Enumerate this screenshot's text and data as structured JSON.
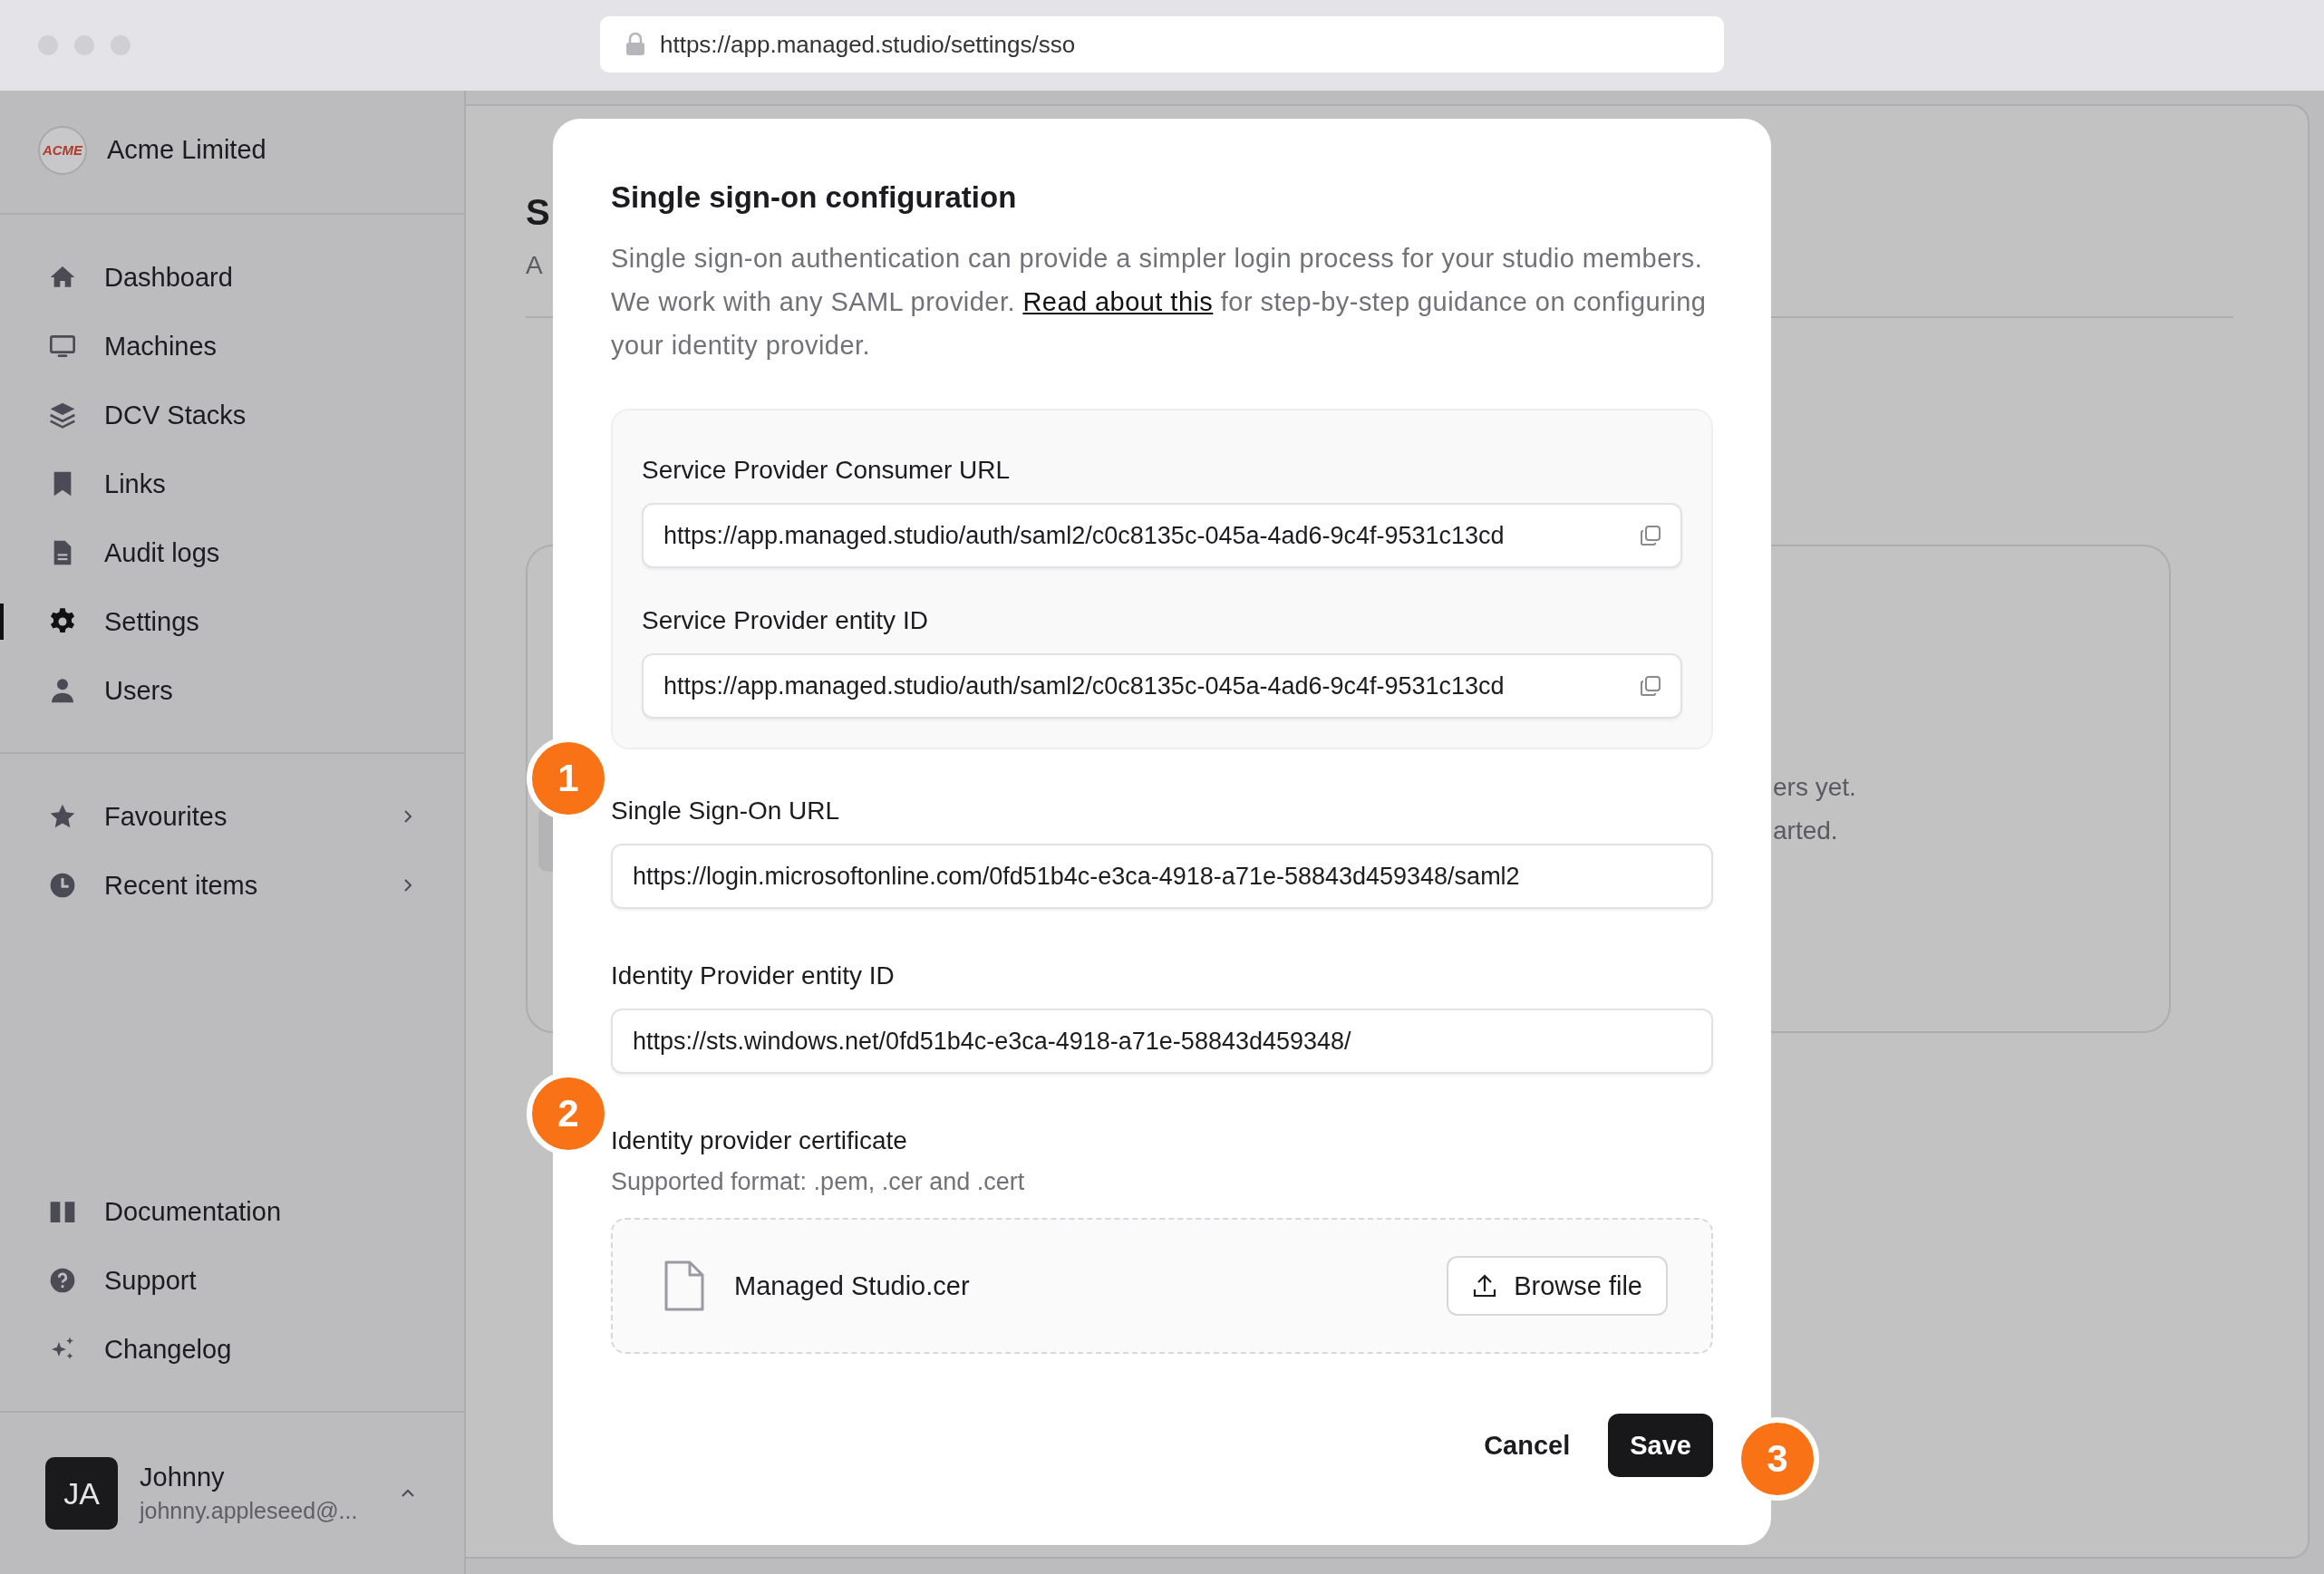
{
  "browser": {
    "url": "https://app.managed.studio/settings/sso"
  },
  "sidebar": {
    "org": {
      "logo_text": "ACME",
      "name": "Acme Limited"
    },
    "nav_main": [
      {
        "label": "Dashboard",
        "selected": false
      },
      {
        "label": "Machines",
        "selected": false
      },
      {
        "label": "DCV Stacks",
        "selected": false
      },
      {
        "label": "Links",
        "selected": false
      },
      {
        "label": "Audit logs",
        "selected": false
      },
      {
        "label": "Settings",
        "selected": true
      },
      {
        "label": "Users",
        "selected": false
      }
    ],
    "nav_secondary": [
      {
        "label": "Favourites",
        "expandable": true
      },
      {
        "label": "Recent items",
        "expandable": true
      }
    ],
    "nav_footer": [
      {
        "label": "Documentation"
      },
      {
        "label": "Support"
      },
      {
        "label": "Changelog"
      }
    ],
    "user": {
      "initials": "JA",
      "name": "Johnny",
      "email": "johnny.appleseed@..."
    }
  },
  "page": {
    "title": "S",
    "subtitle": "A",
    "empty_state": [
      "ers yet.",
      "arted."
    ]
  },
  "modal": {
    "title": "Single sign-on configuration",
    "description": {
      "before": "Single sign-on authentication can provide a simpler login process for your studio members. We work with any SAML provider. ",
      "link": "Read about this",
      "after": " for step-by-step guidance on configuring your identity provider."
    },
    "service_provider": [
      {
        "label": "Service Provider Consumer URL",
        "value": "https://app.managed.studio/auth/saml2/c0c8135c-045a-4ad6-9c4f-9531c13cd"
      },
      {
        "label": "Service Provider entity ID",
        "value": "https://app.managed.studio/auth/saml2/c0c8135c-045a-4ad6-9c4f-9531c13cd"
      }
    ],
    "fields": [
      {
        "label": "Single Sign-On URL",
        "value": "https://login.microsoftonline.com/0fd51b4c-e3ca-4918-a71e-58843d459348/saml2"
      },
      {
        "label": "Identity Provider entity ID",
        "value": "https://sts.windows.net/0fd51b4c-e3ca-4918-a71e-58843d459348/"
      }
    ],
    "certificate": {
      "label": "Identity provider certificate",
      "hint": "Supported format: .pem, .cer and .cert",
      "file_name": "Managed Studio.cer",
      "button": "Browse file"
    },
    "cancel": "Cancel",
    "save": "Save",
    "step_badges": [
      "1",
      "2",
      "3"
    ]
  }
}
